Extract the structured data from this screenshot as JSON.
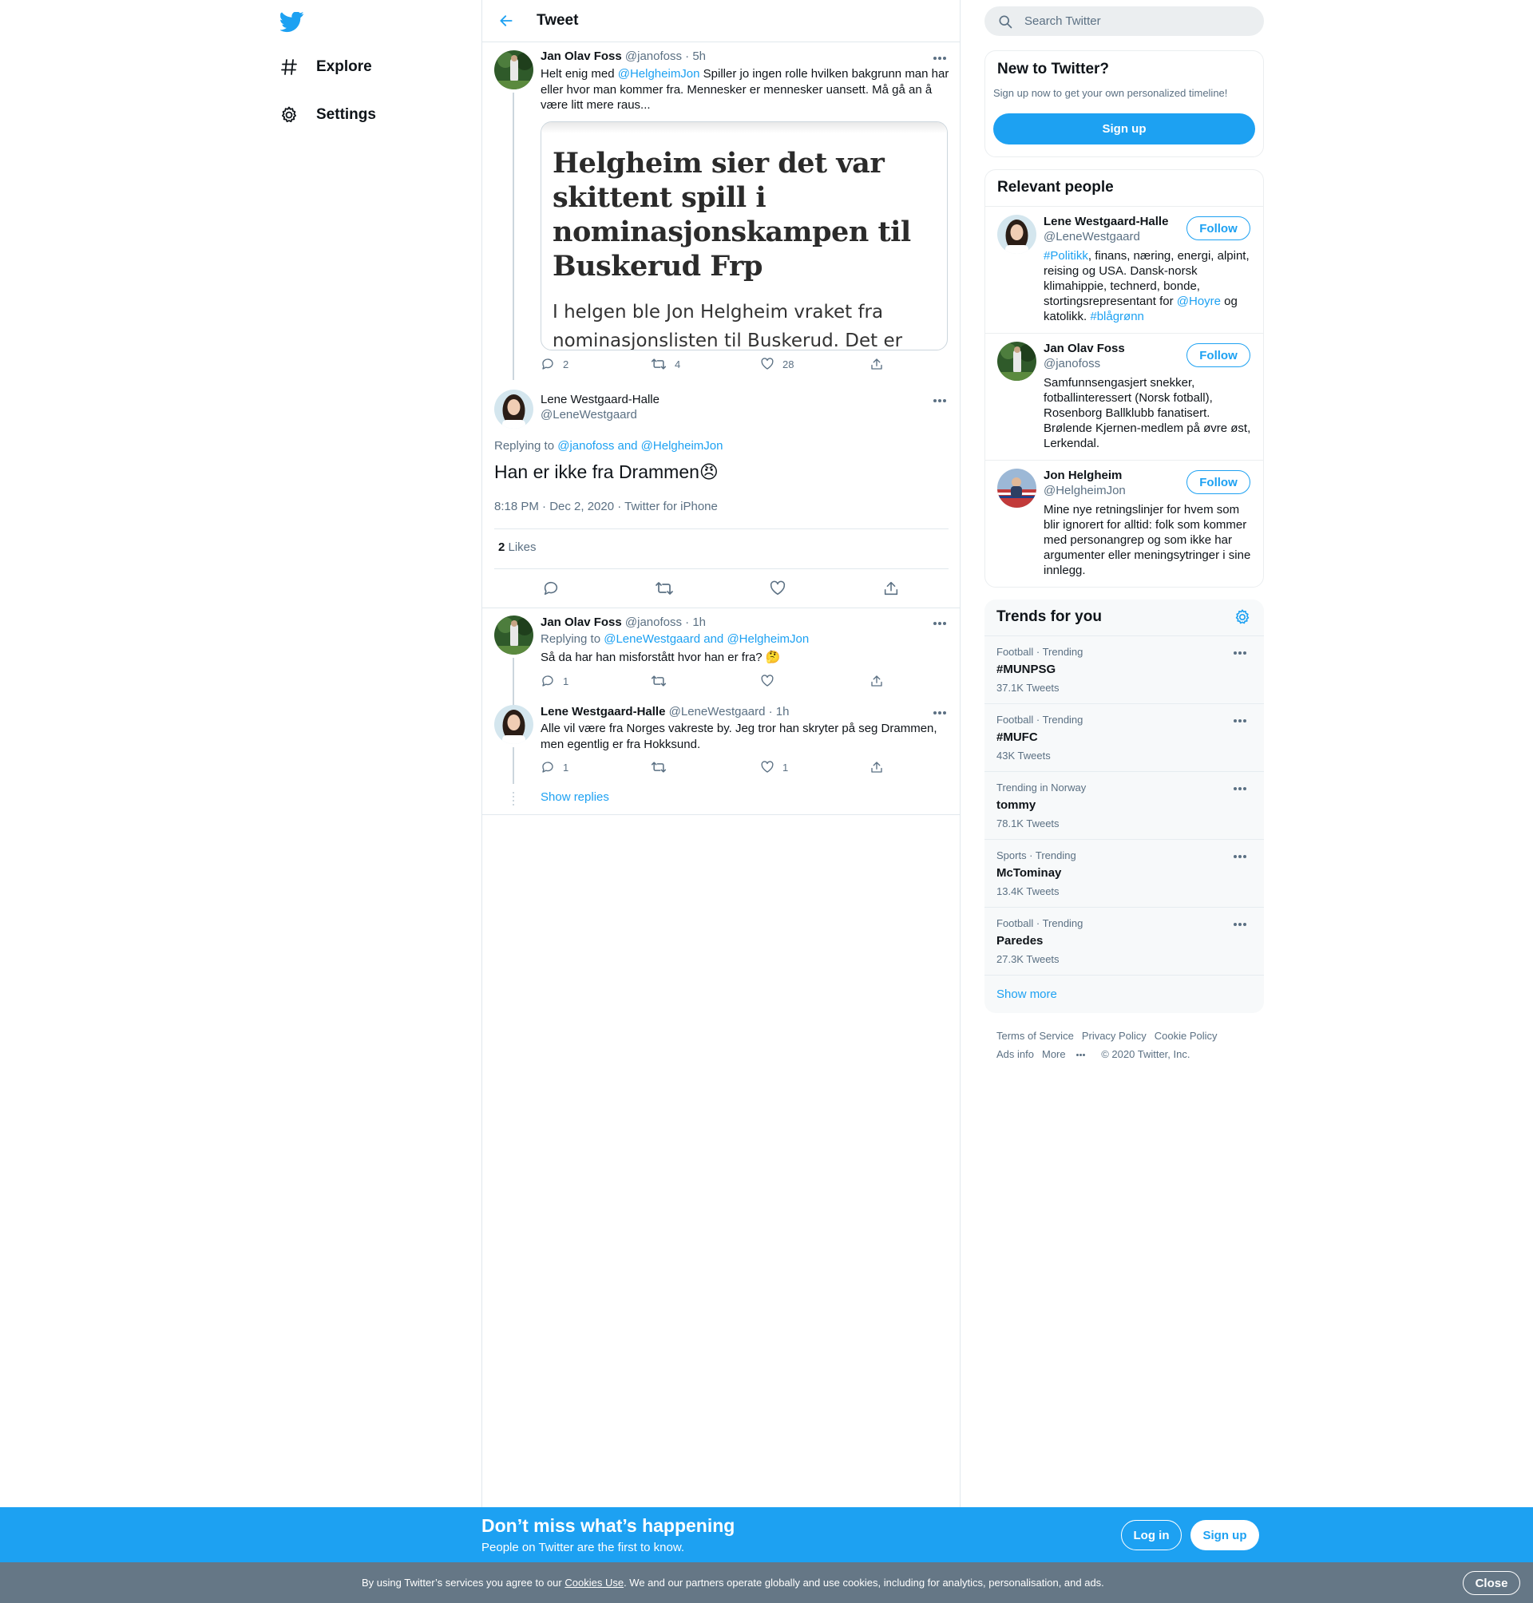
{
  "nav": {
    "logo_icon": "twitter-bird-icon",
    "items": [
      {
        "label": "Explore",
        "icon": "hashtag-icon"
      },
      {
        "label": "Settings",
        "icon": "gear-icon"
      }
    ]
  },
  "header": {
    "title": "Tweet"
  },
  "thread": {
    "parent": {
      "name": "Jan Olav Foss",
      "meta": "@janofoss · 5h",
      "text_pre": "Helt enig med ",
      "mention": "@HelgheimJon",
      "text_post": " Spiller jo ingen rolle hvilken bakgrunn man har eller hvor man kommer fra. Mennesker er mennesker uansett. Må gå an å være litt mere raus...",
      "card_headline": "Helgheim sier det var skittent spill i nominasjonskampen til Buskerud Frp",
      "card_body": "I helgen ble Jon Helgheim vraket fra nominasjonslisten til Buskerud. Det er fordi",
      "replies": "2",
      "retweets": "4",
      "likes": "28"
    },
    "focus": {
      "name": "Lene Westgaard-Halle",
      "handle": "@LeneWestgaard",
      "replying_prefix": "Replying to ",
      "replying_to": "@janofoss and @HelgheimJon",
      "text": "Han er ikke fra Drammen",
      "emoji": "😠",
      "timestamp": "8:18 PM · Dec 2, 2020 · Twitter for iPhone",
      "likes_count": "2",
      "likes_label": " Likes"
    },
    "replies": [
      {
        "name": "Jan Olav Foss",
        "meta": "@janofoss · 1h",
        "replying_prefix": "Replying to ",
        "replying_to": "@LeneWestgaard and @HelgheimJon",
        "text": "Så da har han misforstått hvor han er fra?",
        "emoji": "🤔",
        "replies": "1",
        "retweets": "",
        "likes": ""
      },
      {
        "name": "Lene Westgaard-Halle",
        "meta": "@LeneWestgaard · 1h",
        "text": "Alle vil være fra Norges vakreste by. Jeg tror han skryter på seg Drammen, men egentlig er fra Hokksund.",
        "replies": "1",
        "retweets": "",
        "likes": "1"
      }
    ],
    "show_replies": "Show replies"
  },
  "search": {
    "placeholder": "Search Twitter"
  },
  "new_to_twitter": {
    "title": "New to Twitter?",
    "subtitle": "Sign up now to get your own personalized timeline!",
    "button": "Sign up"
  },
  "relevant_people": {
    "title": "Relevant people",
    "follow_label": "Follow",
    "people": [
      {
        "name": "Lene Westgaard-Halle",
        "handle": "@LeneWestgaard",
        "bio_parts": [
          "#Politikk",
          ", finans, næring, energi, alpint, reising og USA. Dansk-norsk klimahippie, technerd, bonde, stortingsrepresentant for ",
          "@Hoyre",
          " og katolikk. ",
          "#blågrønn"
        ]
      },
      {
        "name": "Jan Olav Foss",
        "handle": "@janofoss",
        "bio": "Samfunnsengasjert snekker, fotballinteressert (Norsk fotball), Rosenborg Ballklubb fanatisert. Brølende Kjernen-medlem på øvre øst, Lerkendal."
      },
      {
        "name": "Jon Helgheim",
        "handle": "@HelgheimJon",
        "bio": "Mine nye retningslinjer for hvem som blir ignorert for alltid: folk som kommer med personangrep og som ikke har argumenter eller meningsytringer i sine innlegg."
      }
    ]
  },
  "trends": {
    "title": "Trends for you",
    "items": [
      {
        "meta": "Football · Trending",
        "name": "#MUNPSG",
        "count": "37.1K Tweets"
      },
      {
        "meta": "Football · Trending",
        "name": "#MUFC",
        "count": "43K Tweets"
      },
      {
        "meta": "Trending in Norway",
        "name": "tommy",
        "count": "78.1K Tweets"
      },
      {
        "meta": "Sports · Trending",
        "name": "McTominay",
        "count": "13.4K Tweets"
      },
      {
        "meta": "Football · Trending",
        "name": "Paredes",
        "count": "27.3K Tweets"
      }
    ],
    "show_more": "Show more"
  },
  "footer": {
    "links": [
      "Terms of Service",
      "Privacy Policy",
      "Cookie Policy",
      "Ads info",
      "More"
    ],
    "copyright": "© 2020 Twitter, Inc."
  },
  "bottom_bar": {
    "title": "Don’t miss what’s happening",
    "subtitle": "People on Twitter are the first to know.",
    "login": "Log in",
    "signup": "Sign up"
  },
  "cookie": {
    "pre": "By using Twitter’s services you agree to our ",
    "link": "Cookies Use",
    "post": ". We and our partners operate globally and use cookies, including for analytics, personalisation, and ads.",
    "close": "Close"
  },
  "colors": {
    "accent": "#1da1f2",
    "muted": "#5b7083",
    "cookie_bar": "#657786"
  }
}
